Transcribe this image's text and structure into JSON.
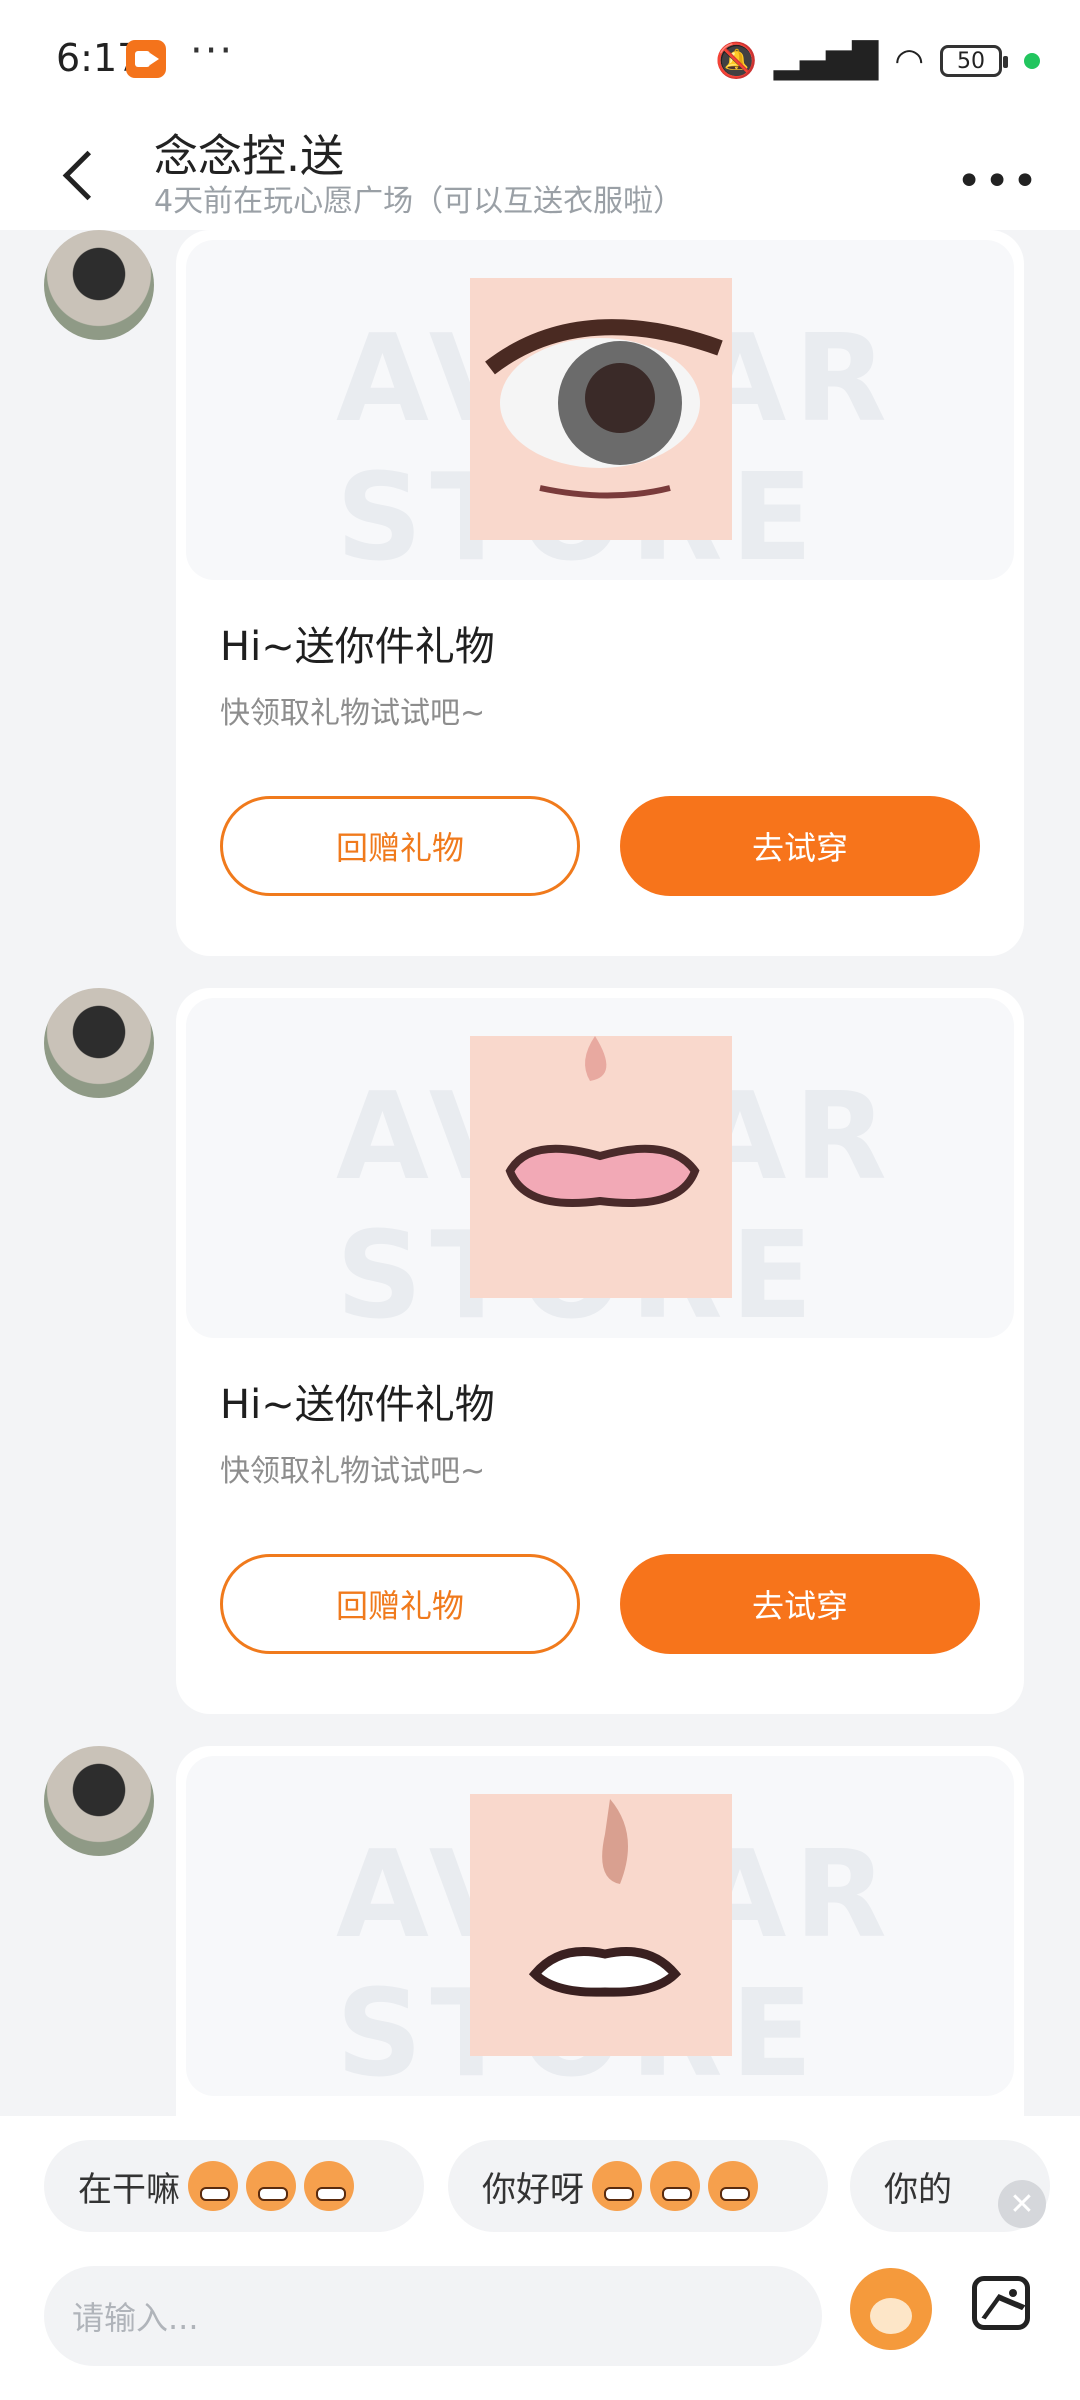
{
  "status_bar": {
    "time": "6:17",
    "more": "···",
    "battery": "50",
    "icons": [
      "mute-bell-icon",
      "hd-signal-icon",
      "wifi-icon",
      "battery-icon"
    ]
  },
  "header": {
    "title": "念念控.送",
    "subtitle": "4天前在玩心愿广场（可以互送衣服啦）",
    "more": "•••"
  },
  "messages": [
    {
      "title": "Hi~送你件礼物",
      "desc": "快领取礼物试试吧~",
      "btn_return": "回赠礼物",
      "btn_try": "去试穿",
      "watermark": "AVATAR STORE",
      "item_icon": "eye-icon"
    },
    {
      "title": "Hi~送你件礼物",
      "desc": "快领取礼物试试吧~",
      "btn_return": "回赠礼物",
      "btn_try": "去试穿",
      "watermark": "AVATAR STORE",
      "item_icon": "mouth-icon"
    },
    {
      "title": "",
      "desc": "",
      "btn_return": "",
      "btn_try": "",
      "watermark": "AVATAR STORE",
      "item_icon": "mouth-icon"
    }
  ],
  "quick_replies": [
    {
      "text": "在干嘛"
    },
    {
      "text": "你好呀"
    },
    {
      "text": "你的"
    }
  ],
  "input": {
    "placeholder": "请输入..."
  },
  "colors": {
    "accent": "#f7741b",
    "background": "#f3f4f6"
  }
}
